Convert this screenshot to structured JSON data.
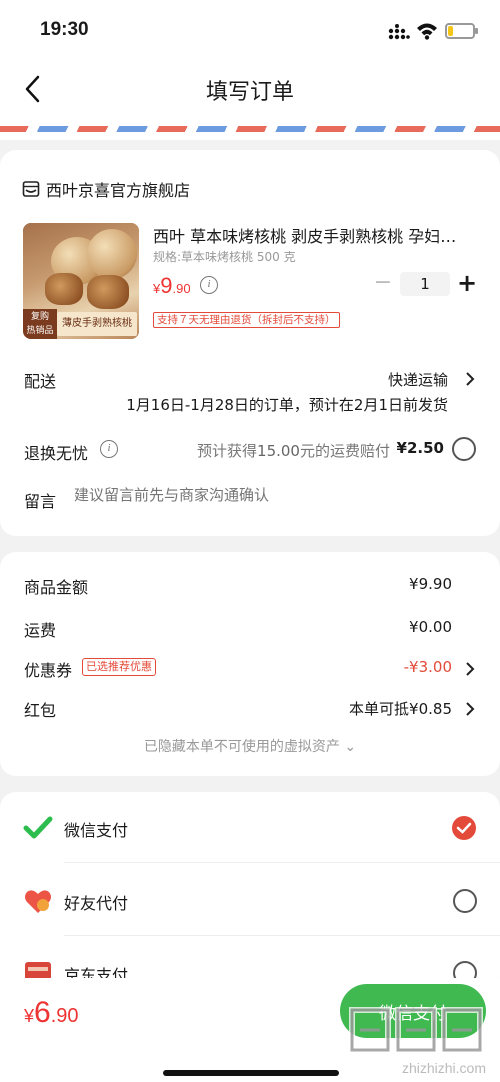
{
  "status_bar": {
    "time": "19:30",
    "battery_level": 0.2
  },
  "header": {
    "title": "填写订单"
  },
  "shop": {
    "name": "西叶京喜官方旗舰店"
  },
  "product": {
    "title": "西叶 草本味烤核桃 剥皮手剥熟核桃 孕妇…",
    "spec": "规格:草本味烤核桃 500 克",
    "price_currency": "¥",
    "price_int": "9",
    "price_dec": ".90",
    "quantity": "1",
    "return_policy": "支持７天无理由退货（拆封后不支持）",
    "image_badge": "复购\n热销品",
    "image_caption": "薄皮手剥熟核桃"
  },
  "delivery": {
    "label": "配送",
    "method": "快递运输",
    "note": "1月16日-1月28日的订单，预计在2月1日前发货"
  },
  "refund": {
    "label": "退换无忧",
    "desc_prefix": "预计获得",
    "desc_amount": "15.00",
    "desc_suffix": "元的运费赔付",
    "price": "¥2.50"
  },
  "message": {
    "label": "留言",
    "placeholder": "建议留言前先与商家沟通确认"
  },
  "summary": {
    "goods_label": "商品金额",
    "goods_value": "¥9.90",
    "shipping_label": "运费",
    "shipping_value": "¥0.00",
    "coupon_label": "优惠券",
    "coupon_tag": "已选推荐优惠",
    "coupon_value": "-¥3.00",
    "redpacket_label": "红包",
    "redpacket_value": "本单可抵¥0.85",
    "hidden_assets": "已隐藏本单不可使用的虚拟资产 ⌄"
  },
  "payment": {
    "options": [
      {
        "label": "微信支付",
        "selected": true
      },
      {
        "label": "好友代付",
        "selected": false
      },
      {
        "label": "京东支付",
        "selected": false
      }
    ]
  },
  "bottom": {
    "total_currency": "¥",
    "total_int": "6",
    "total_dec": ".90",
    "pay_button": "微信支付",
    "watermark": "zhizhizhi.com"
  },
  "colors": {
    "accent_red": "#e34a3a",
    "wechat_green": "#3fb950"
  }
}
